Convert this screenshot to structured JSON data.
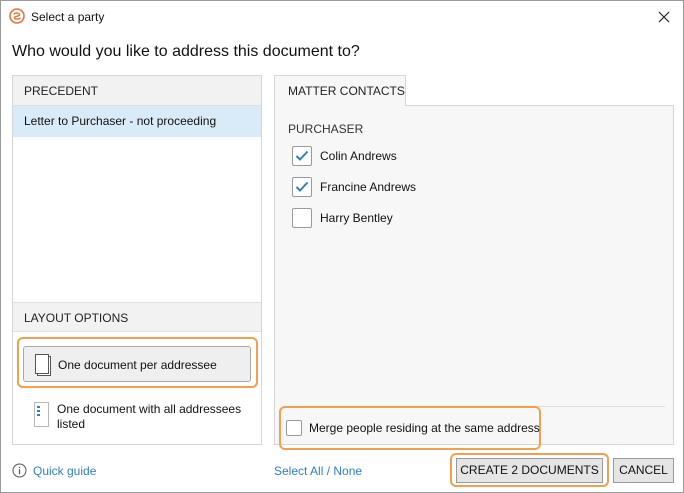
{
  "window": {
    "title": "Select a party",
    "app_icon": "app-logo-icon",
    "close_icon": "close-icon"
  },
  "question": "Who would you like to address this document to?",
  "precedent": {
    "header": "PRECEDENT",
    "items": [
      {
        "label": "Letter to Purchaser - not proceeding",
        "selected": true
      }
    ]
  },
  "layout_options": {
    "header": "LAYOUT OPTIONS",
    "options": [
      {
        "label": "One document per addressee",
        "selected": true,
        "icon": "single-document-icon"
      },
      {
        "label": "One document with all addressees listed",
        "selected": false,
        "icon": "list-document-icon"
      }
    ]
  },
  "contacts": {
    "tab_label": "MATTER CONTACTS",
    "group": "PURCHASER",
    "items": [
      {
        "name": "Colin Andrews",
        "checked": true
      },
      {
        "name": "Francine Andrews",
        "checked": true
      },
      {
        "name": "Harry Bentley",
        "checked": false
      }
    ],
    "merge_label": "Merge people residing at the same address",
    "merge_checked": false
  },
  "footer": {
    "quick_guide": "Quick guide",
    "quick_guide_icon": "info-icon",
    "select_all": "Select All / None",
    "create_button": "CREATE 2 DOCUMENTS",
    "cancel_button": "CANCEL"
  },
  "colors": {
    "accent_link": "#2f7fc1",
    "selection": "#d9ebf8",
    "highlight": "#f0a050",
    "check": "#2f7fc1"
  }
}
